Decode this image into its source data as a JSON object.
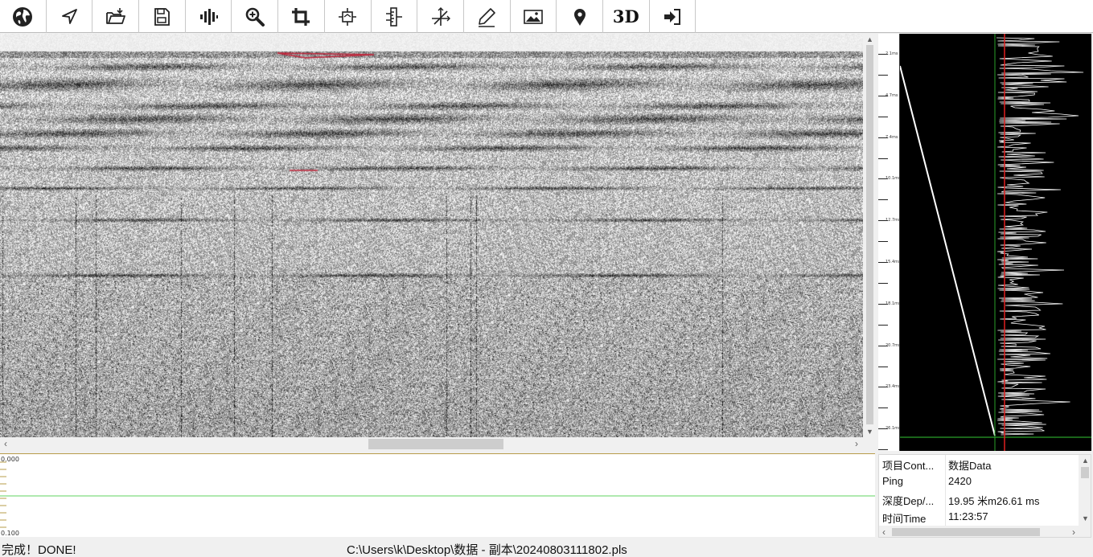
{
  "toolbar": {
    "buttons": [
      {
        "name": "globe-button",
        "icon": "globe-icon"
      },
      {
        "name": "navigate-button",
        "icon": "navigation-arrow-icon"
      },
      {
        "name": "open-folder-button",
        "icon": "folder-open-icon"
      },
      {
        "name": "save-button",
        "icon": "floppy-disk-icon"
      },
      {
        "name": "signal-button",
        "icon": "waveform-bars-icon"
      },
      {
        "name": "zoom-button",
        "icon": "zoom-in-icon"
      },
      {
        "name": "crop-button",
        "icon": "crop-icon"
      },
      {
        "name": "gain-button",
        "icon": "box-arrows-icon"
      },
      {
        "name": "ruler-button",
        "icon": "ruler-icon"
      },
      {
        "name": "axis-button",
        "icon": "axis-cross-icon"
      },
      {
        "name": "annotate-button",
        "icon": "pen-icon"
      },
      {
        "name": "image-button",
        "icon": "image-icon"
      },
      {
        "name": "marker-button",
        "icon": "map-pin-icon"
      },
      {
        "name": "view-3d-button",
        "label": "3D"
      },
      {
        "name": "exit-button",
        "icon": "exit-arrow-icon"
      }
    ]
  },
  "profile": {
    "tick_labels": [
      "2.1ms",
      "4.7ms",
      "7.4ms",
      "10.1ms",
      "12.7ms",
      "15.4ms",
      "18.1ms",
      "20.7ms",
      "23.4ms",
      "26.1ms"
    ],
    "colors": {
      "background": "#000000",
      "trace": "#ffffff",
      "depth_line": "#e02020",
      "grid_line": "#2aa02a"
    }
  },
  "bottom_chart": {
    "top_label": "0.000",
    "bottom_label": "0.100",
    "colors": {
      "level_line": "#5fd35f",
      "border": "#b79c4a"
    }
  },
  "info": {
    "rows": [
      {
        "key": "项目Cont...",
        "value": "数据Data"
      },
      {
        "key": "Ping",
        "value": "2420"
      },
      {
        "key": "深度Dep/...",
        "value": "19.95 米m26.61 ms"
      },
      {
        "key": "时间Time",
        "value": "  11:23:57"
      }
    ]
  },
  "status": {
    "message": "完成！DONE!",
    "file_path": "C:\\Users\\k\\Desktop\\数据 - 副本\\20240803111802.pls"
  }
}
